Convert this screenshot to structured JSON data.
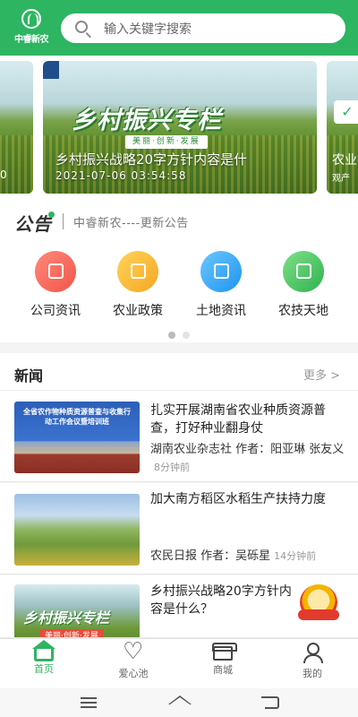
{
  "header": {
    "logo_text": "中睿新农",
    "search_placeholder": "输入关键字搜索"
  },
  "banner": {
    "title": "乡村振兴专栏",
    "slogan": "美丽·创新·发展",
    "caption": "乡村振兴战略20字方针内容是什",
    "date": "2021-07-06 03:54:58",
    "left_edge_text": "0",
    "right_edge_text": "农业",
    "right_edge_sub": "观产"
  },
  "notice": {
    "label": "公告",
    "text": "中睿新农----更新公告"
  },
  "quick_menu": [
    {
      "label": "公司资讯",
      "icon": "megaphone-icon",
      "color": "#f2544a"
    },
    {
      "label": "农业政策",
      "icon": "document-icon",
      "color": "#f5a623"
    },
    {
      "label": "土地资讯",
      "icon": "land-icon",
      "color": "#1e94f0"
    },
    {
      "label": "农技天地",
      "icon": "book-icon",
      "color": "#2eb24d"
    }
  ],
  "news": {
    "title": "新闻",
    "more": "更多 >",
    "items": [
      {
        "headline": "扎实开展湖南省农业种质资源普查，打好种业翻身仗",
        "source": "湖南农业杂志社 作者：阳亚琳 张友义",
        "time": "8分钟前",
        "thumb_text": "全省农作物种质资源普查与收集行动工作会议暨培训班"
      },
      {
        "headline": "加大南方稻区水稻生产扶持力度",
        "source": "农民日报 作者：吴砾星",
        "time": "14分钟前"
      },
      {
        "headline": "乡村振兴战略20字方针内容是什么？",
        "thumb_title": "乡村振兴专栏",
        "thumb_slogan": "美丽·创新·发展"
      }
    ]
  },
  "tabbar": [
    {
      "label": "首页",
      "icon": "home-icon",
      "active": true
    },
    {
      "label": "爱心池",
      "icon": "heart-icon",
      "active": false
    },
    {
      "label": "商城",
      "icon": "shop-icon",
      "active": false
    },
    {
      "label": "我的",
      "icon": "user-icon",
      "active": false
    }
  ],
  "colors": {
    "brand_green": "#2db562"
  }
}
